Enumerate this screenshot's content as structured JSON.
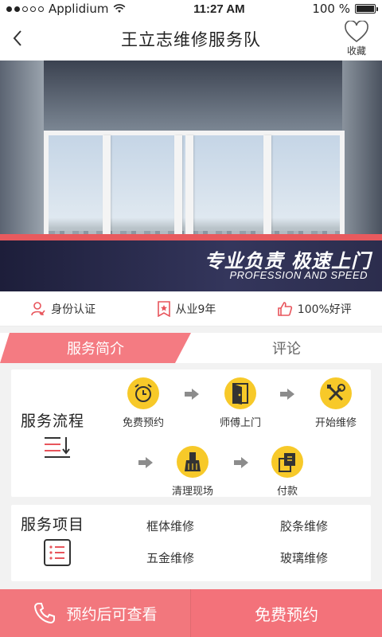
{
  "status_bar": {
    "carrier": "Applidium",
    "time": "11:27 AM",
    "battery": "100 %"
  },
  "nav": {
    "title": "王立志维修服务队",
    "favorite_label": "收藏"
  },
  "banner": {
    "slogan_cn": "专业负责 极速上门",
    "slogan_en": "PROFESSION AND SPEED"
  },
  "badges": [
    {
      "label": "身份认证",
      "icon": "user-verified-icon"
    },
    {
      "label": "从业9年",
      "icon": "certificate-icon"
    },
    {
      "label": "100%好评",
      "icon": "thumbs-up-icon"
    }
  ],
  "tabs": {
    "intro": "服务简介",
    "reviews": "评论"
  },
  "service_flow": {
    "title": "服务流程",
    "steps": [
      {
        "label": "免费预约",
        "icon": "alarm-clock-icon"
      },
      {
        "label": "师傅上门",
        "icon": "door-icon"
      },
      {
        "label": "开始维修",
        "icon": "tools-icon"
      },
      {
        "label": "清理现场",
        "icon": "broom-icon"
      },
      {
        "label": "付款",
        "icon": "payment-icon"
      }
    ]
  },
  "service_items": {
    "title": "服务项目",
    "items": [
      "框体维修",
      "胶条维修",
      "五金维修",
      "玻璃维修"
    ]
  },
  "bottom_bar": {
    "call_label": "预约后可查看",
    "book_label": "免费预约"
  },
  "colors": {
    "accent": "#f3727a",
    "icon_yellow": "#f7c929"
  }
}
